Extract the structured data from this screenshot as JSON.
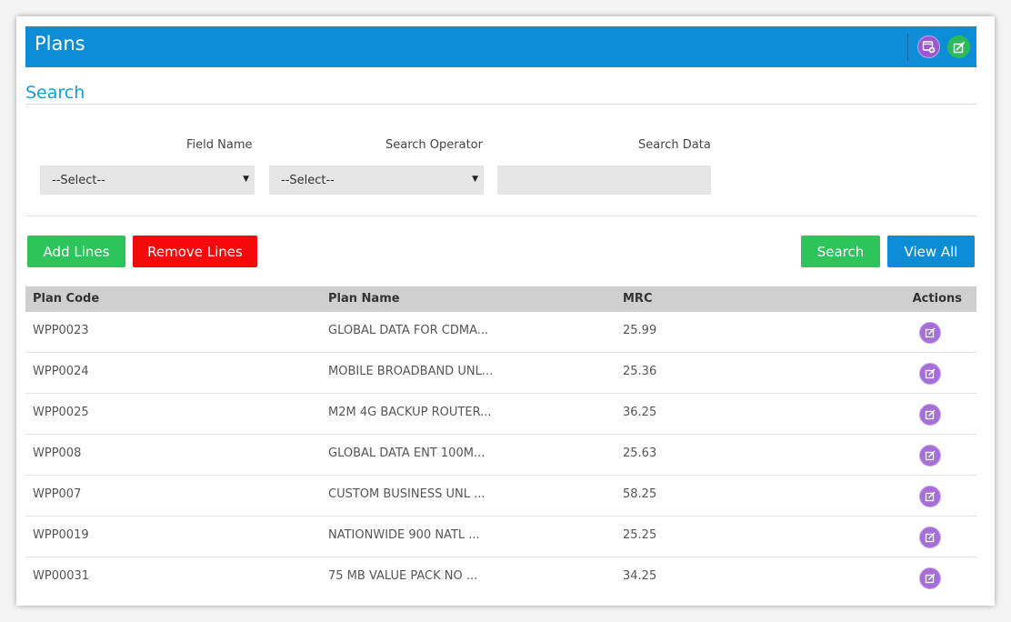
{
  "header": {
    "title": "Plans"
  },
  "search": {
    "title": "Search",
    "field_name_label": "Field Name",
    "operator_label": "Search Operator",
    "data_label": "Search Data",
    "field_name_value": "--Select--",
    "operator_value": "--Select--",
    "data_value": ""
  },
  "buttons": {
    "add_lines": "Add Lines",
    "remove_lines": "Remove Lines",
    "search": "Search",
    "view_all": "View All"
  },
  "table": {
    "columns": [
      "Plan Code",
      "Plan Name",
      "MRC",
      "Actions"
    ],
    "rows": [
      {
        "code": "WPP0023",
        "name": "GLOBAL DATA FOR CDMA...",
        "mrc": "25.99"
      },
      {
        "code": "WPP0024",
        "name": "MOBILE BROADBAND UNL...",
        "mrc": "25.36"
      },
      {
        "code": "WPP0025",
        "name": "M2M 4G BACKUP ROUTER...",
        "mrc": "36.25"
      },
      {
        "code": "WPP008",
        "name": "GLOBAL DATA ENT 100M...",
        "mrc": "25.63"
      },
      {
        "code": "WPP007",
        "name": "CUSTOM BUSINESS UNL ...",
        "mrc": "58.25"
      },
      {
        "code": "WPP0019",
        "name": "NATIONWIDE 900 NATL ...",
        "mrc": "25.25"
      },
      {
        "code": "WP00031",
        "name": "75 MB VALUE PACK NO ...",
        "mrc": "34.25"
      }
    ]
  },
  "colors": {
    "header": "#0d8dd6",
    "green": "#2dc45c",
    "red": "#f40a0a",
    "action_purple": "#a66fd8"
  },
  "icons": {
    "header_add": "add-window-icon",
    "header_edit": "edit-icon",
    "row_action": "edit-icon"
  }
}
